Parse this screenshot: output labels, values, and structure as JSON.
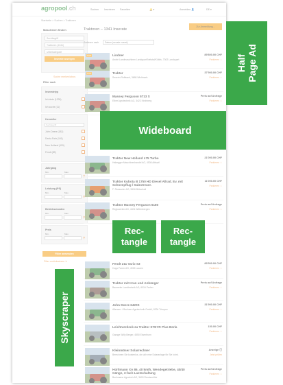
{
  "header": {
    "logo_main": "agropool",
    "logo_tld": ".ch",
    "nav": [
      "Suchen",
      "Inserieren",
      "Favoriten",
      "🔔 ▾",
      "Anmelden 👤",
      "DE ▾"
    ]
  },
  "breadcrumb": "Startseite > Suchen > Traktoren",
  "search_button": "Zur Anmeldung...",
  "sidebar": {
    "title": "Maschinen finden",
    "search_placeholder": "Suchbegriff",
    "category": "Traktoren (1341)",
    "subcategory": "Unterkategorie",
    "show_button": "Inserate anzeigen",
    "save_link": "Suche merken/abon.",
    "filter_title": "Filter nach",
    "insertionsart_title": "Inseratetyp",
    "insertionsart": [
      "Ich biete (1330)",
      "Ich suche (11)"
    ],
    "hersteller_title": "Hersteller",
    "hersteller_placeholder": "Suchbegriff",
    "hersteller": [
      "John Deere (182)",
      "Deutz-Fahr (161)",
      "New Holland (115)",
      "Fendt (89)"
    ],
    "jahrgang_title": "Jahrgang",
    "leistung_title": "Leistung (PS)",
    "betriebsstunden_title": "Betriebsstunden",
    "preis_title": "Preis",
    "min": "Min.",
    "max": "Max.",
    "apply_button": "Filter anwenden",
    "reset_link": "Filter zurücksetzen ✕"
  },
  "main": {
    "title": "Traktoren – 1341 Inserate",
    "sort_label": "Sortieren nach",
    "sort_value": "Datum (neuste zuerst)"
  },
  "listings": [
    {
      "title": "Lindner",
      "sub": "Andrè Landmaschinen Landquart/Netstal/Küblis, 7302 Landquart",
      "price": "89'800.00 CHF",
      "park": "Parkieren ☆",
      "badge": "TOP"
    },
    {
      "title": "Traktor",
      "sub": "Severin Roffeach, 3668 Wichtrach",
      "price": "37'900.00 CHF",
      "park": "Parkieren ☆",
      "badge": "TOP"
    },
    {
      "title": "Massey Ferguson 5713 S",
      "sub": "Elber Agrotechnik AG, 3422 Kirchberg",
      "price": "Preis auf Anfrage",
      "park": "Parkieren ☆",
      "badge": ""
    },
    {
      "title": "Traktor New Holland L75 Turbo",
      "sub": "Habegger Maschinenhandel AG, 4536 Attiswil",
      "price": "21'000.00 CHF",
      "park": "Parkieren ☆",
      "badge": ""
    },
    {
      "title": "Traktor Kubota B 1750 HD Diesel Allrad. Ev. mit Schneepflug / Salzstreuer.",
      "sub": "F. Ruesseler AG, 9606 Bütschwil",
      "price": "11'000.00 CHF",
      "park": "Parkieren ☆",
      "badge": ""
    },
    {
      "title": "Traktor Massey Ferguson 6180",
      "sub": "Regiocenter AG, 4401 Wittenbergen",
      "price": "Preis auf Anfrage",
      "park": "Parkieren ☆",
      "badge": ""
    },
    {
      "title": "Fendt 211 Vario S3",
      "sub": "Hugo Farrer AG, 4915 Lauren",
      "price": "89'500.00 CHF",
      "park": "Parkieren ☆",
      "badge": ""
    },
    {
      "title": "Traktor mit Kran und Anhänger",
      "sub": "Baumeler Landtechnik AG, 6016 Perlen",
      "price": "Preis auf Anfrage",
      "park": "Parkieren ☆",
      "badge": ""
    },
    {
      "title": "John Deere 6420S",
      "sub": "Allenzer + Buchser Agrotechnik GmbH, 8334 Trimpon",
      "price": "31'900.00 CHF",
      "park": "Parkieren ☆",
      "badge": ""
    },
    {
      "title": "Leichtverdeck zu Traktor STEYR Plus Berla",
      "sub": "Garage Willy Berger, 4550 Eisenthurn",
      "price": "150.00 CHF",
      "park": "Parkieren ☆",
      "badge": ""
    },
    {
      "title": "Kleinmöser Solarrechner",
      "sub": "Berechnen Sie kostenlos, ob sich eine Solaranlage für Sie lohnt.",
      "price": "Anzeige ⓘ",
      "park": "Jetzt prüfen",
      "badge": ""
    },
    {
      "title": "Hürlimann XA 86, 40 km/h, Wendegetriebe, 40/40 Gänge, 3-fach Lastschaltung",
      "sub": "Buchmann Agrotech AG, 3600 Remismühle",
      "price": "Preis auf Anfrage",
      "park": "Parkieren ☆",
      "badge": ""
    }
  ],
  "ads": {
    "half_page": "Half Page Ad",
    "wideboard": "Wideboard",
    "rectangle_1": "Rec-\ntangle",
    "rectangle_2": "Rec-\ntangle",
    "skyscraper": "Skyscraper"
  },
  "colors": {
    "ad_green": "#3ba84a",
    "accent_orange": "#f5a623",
    "logo_green": "#2f8f3a"
  }
}
